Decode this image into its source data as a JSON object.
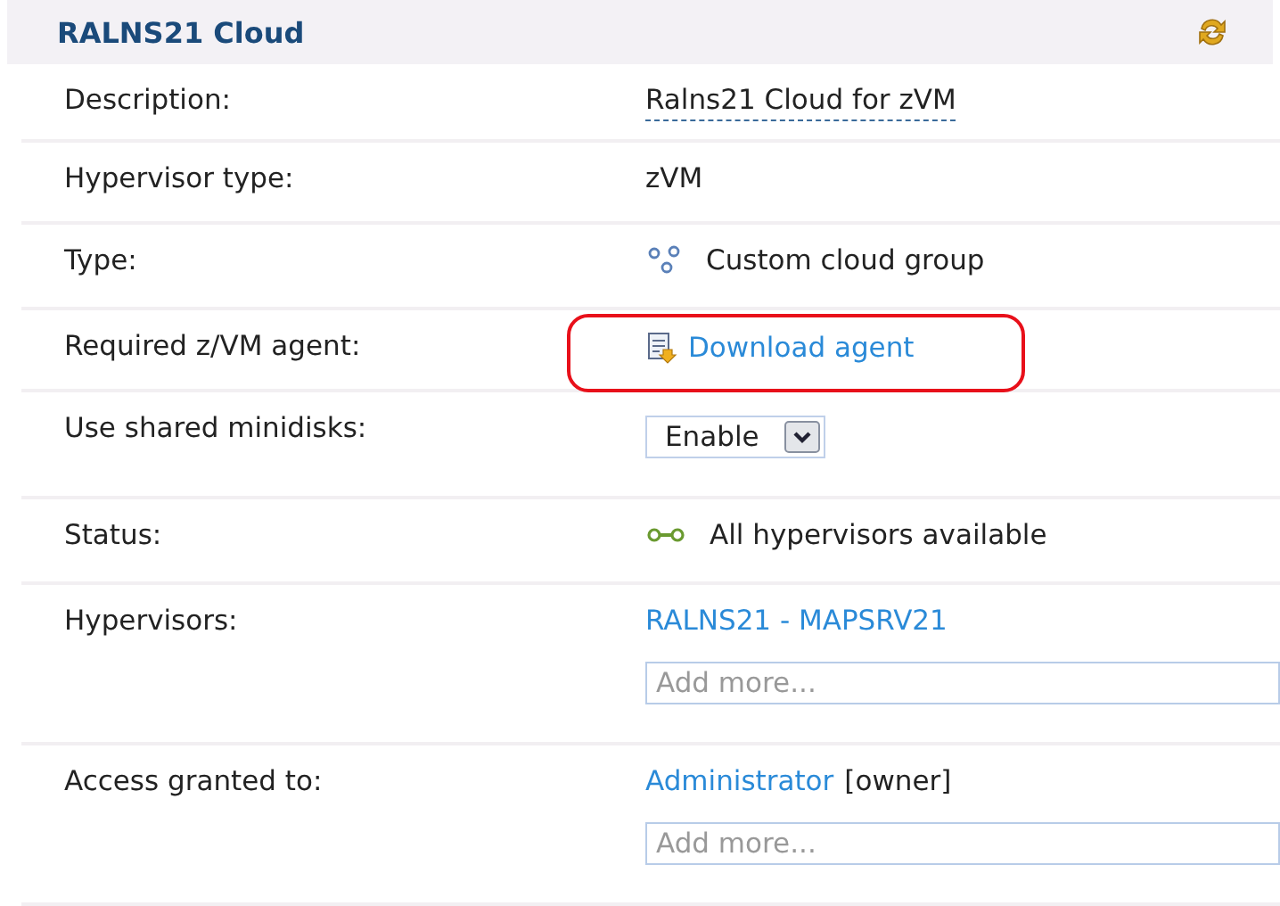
{
  "panel": {
    "title": "RALNS21 Cloud"
  },
  "rows": [
    {
      "label": "Description:",
      "kind": "editable",
      "value": "Ralns21 Cloud for zVM"
    },
    {
      "label": "Hypervisor type:",
      "kind": "text",
      "value": "zVM"
    },
    {
      "label": "Type:",
      "kind": "group",
      "value": "Custom cloud group"
    },
    {
      "label": "Required z/VM agent:",
      "kind": "download",
      "value": "Download agent",
      "highlighted": true
    },
    {
      "label": "Use shared minidisks:",
      "kind": "select",
      "value": "Enable"
    },
    {
      "label": "Status:",
      "kind": "status",
      "value": "All hypervisors available"
    },
    {
      "label": "Hypervisors:",
      "kind": "list",
      "links": [
        {
          "text": "RALNS21 - MAPSRV21"
        }
      ],
      "placeholder": "Add more..."
    },
    {
      "label": "Access granted to:",
      "kind": "list",
      "links": [
        {
          "text": "Administrator",
          "suffix": "[owner]"
        }
      ],
      "placeholder": "Add more..."
    }
  ]
}
